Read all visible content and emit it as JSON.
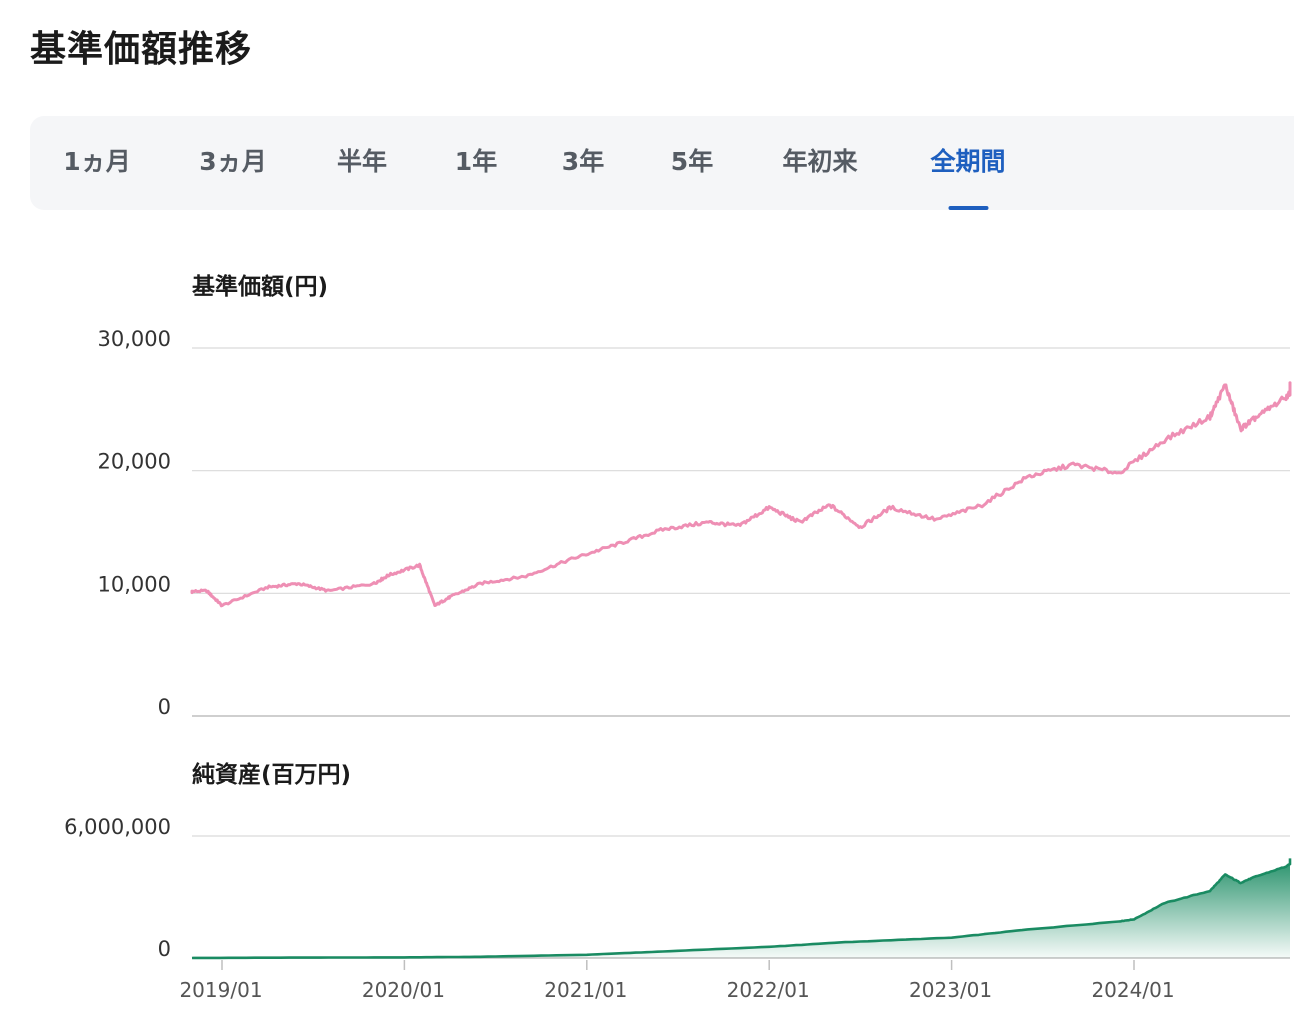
{
  "page": {
    "title": "基準価額推移"
  },
  "tabs": [
    {
      "label": "1ヵ月",
      "active": false
    },
    {
      "label": "3ヵ月",
      "active": false
    },
    {
      "label": "半年",
      "active": false
    },
    {
      "label": "1年",
      "active": false
    },
    {
      "label": "3年",
      "active": false
    },
    {
      "label": "5年",
      "active": false
    },
    {
      "label": "年初来",
      "active": false
    },
    {
      "label": "全期間",
      "active": true
    }
  ],
  "colors": {
    "nav_line": "#ee8fb4",
    "assets_line": "#1a8b62",
    "active_tab": "#1e5fbf"
  },
  "chart_data": [
    {
      "type": "line",
      "title": "基準価額(円)",
      "ylim": [
        0,
        30000
      ],
      "yticks": [
        0,
        10000,
        20000,
        30000
      ],
      "ytick_labels": [
        "0",
        "10,000",
        "20,000",
        "30,000"
      ],
      "x_tick_labels": [
        "2019/01",
        "2020/01",
        "2021/01",
        "2022/01",
        "2023/01",
        "2024/01"
      ],
      "grid": true,
      "series": [
        {
          "color": "#ee8fb4",
          "x": [
            "2018/10",
            "2018/12",
            "2019/01",
            "2019/04",
            "2019/06",
            "2019/08",
            "2019/11",
            "2019/12",
            "2020/02",
            "2020/03",
            "2020/04",
            "2020/06",
            "2020/09",
            "2020/12",
            "2021/03",
            "2021/06",
            "2021/09",
            "2021/11",
            "2022/01",
            "2022/03",
            "2022/05",
            "2022/07",
            "2022/09",
            "2022/12",
            "2023/03",
            "2023/06",
            "2023/09",
            "2023/12",
            "2024/03",
            "2024/06",
            "2024/07",
            "2024/08",
            "2024/09",
            "2024/11",
            "2024/12"
          ],
          "values": [
            10100,
            10200,
            9000,
            10500,
            10800,
            10200,
            10800,
            11500,
            12300,
            9000,
            9700,
            10800,
            11400,
            12800,
            14000,
            15200,
            15800,
            15500,
            17000,
            15800,
            17200,
            15400,
            17000,
            16000,
            17200,
            19500,
            20500,
            19800,
            22500,
            24400,
            27000,
            23400,
            24300,
            26000,
            27200
          ]
        }
      ]
    },
    {
      "type": "area",
      "title": "純資産(百万円)",
      "ylim": [
        0,
        6000000
      ],
      "yticks": [
        0,
        6000000
      ],
      "ytick_labels": [
        "0",
        "6,000,000"
      ],
      "x_tick_labels": [
        "2019/01",
        "2020/01",
        "2021/01",
        "2022/01",
        "2023/01",
        "2024/01"
      ],
      "grid": true,
      "series": [
        {
          "color": "#1a8b62",
          "x": [
            "2018/10",
            "2019/06",
            "2020/01",
            "2020/06",
            "2021/01",
            "2021/06",
            "2022/01",
            "2022/06",
            "2023/01",
            "2023/06",
            "2023/12",
            "2024/01",
            "2024/03",
            "2024/06",
            "2024/07",
            "2024/08",
            "2024/09",
            "2024/11",
            "2024/12"
          ],
          "values": [
            0,
            20000,
            30000,
            60000,
            160000,
            320000,
            550000,
            780000,
            1000000,
            1400000,
            1800000,
            1900000,
            2700000,
            3300000,
            4100000,
            3700000,
            4000000,
            4500000,
            4900000
          ]
        }
      ]
    }
  ]
}
